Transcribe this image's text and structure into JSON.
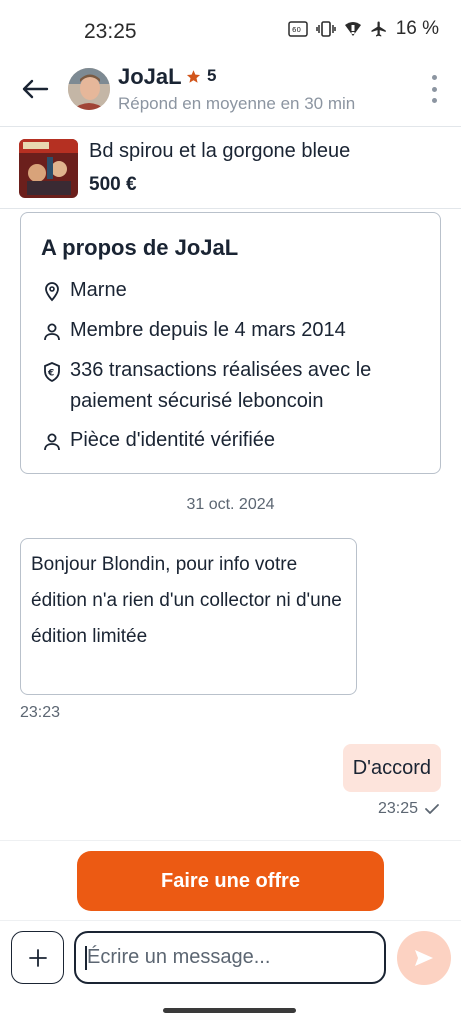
{
  "status_bar": {
    "time": "23:25",
    "battery": "16 %",
    "icons": [
      "hd-voice-icon",
      "vibrate-icon",
      "wifi-icon",
      "airplane-icon"
    ]
  },
  "header": {
    "back_icon": "arrow-left-icon",
    "seller_name": "JoJaL",
    "rating": "5",
    "rating_icon": "star-icon",
    "response_time": "Répond en moyenne en 30 min",
    "menu_icon": "kebab-menu-icon"
  },
  "listing": {
    "title": "Bd spirou et la gorgone bleue",
    "price": "500 €"
  },
  "about": {
    "title": "A propos de JoJaL",
    "rows": [
      {
        "icon": "location-pin-icon",
        "text": "Marne"
      },
      {
        "icon": "user-icon",
        "text": "Membre depuis le 4 mars 2014"
      },
      {
        "icon": "secure-payment-icon",
        "text": "336 transactions réalisées avec le paiement sécurisé leboncoin"
      },
      {
        "icon": "user-icon",
        "text": "Pièce d'identité vérifiée"
      }
    ]
  },
  "conversation": {
    "date": "31 oct. 2024",
    "messages": [
      {
        "direction": "in",
        "text": "Bonjour Blondin, pour info votre édition n'a rien d'un collector ni d'une édition limitée",
        "time": "23:23"
      },
      {
        "direction": "out",
        "text": "D'accord",
        "time": "23:25",
        "status_icon": "check-icon"
      }
    ]
  },
  "actions": {
    "offer_button": "Faire une offre"
  },
  "compose": {
    "placeholder": "Écrire un message...",
    "plus_icon": "plus-icon",
    "send_icon": "send-icon"
  },
  "colors": {
    "accent": "#ec5a13",
    "outgoing_bubble": "#fde4dc",
    "send_disabled": "#fcd2c2",
    "text": "#1a2433"
  }
}
